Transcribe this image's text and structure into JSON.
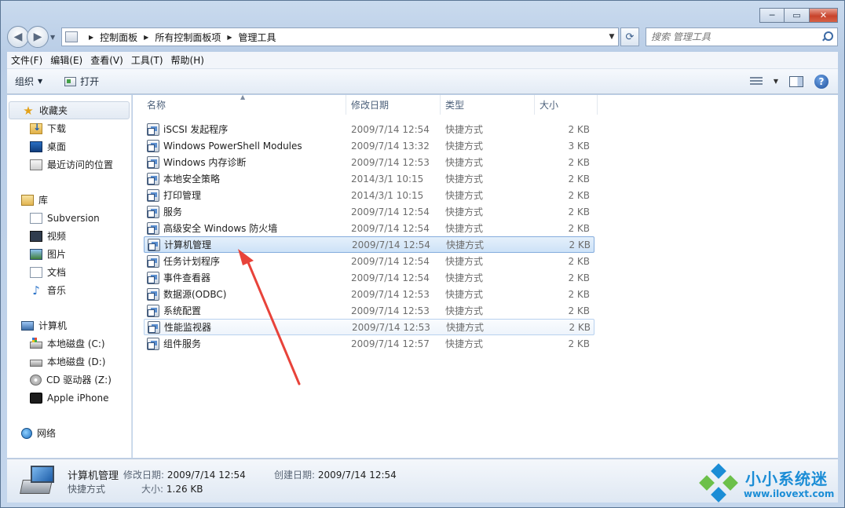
{
  "window": {
    "caption": {
      "min": "─",
      "max": "▭",
      "close": "✕"
    }
  },
  "address": {
    "crumbs": [
      "控制面板",
      "所有控制面板项",
      "管理工具"
    ],
    "search_placeholder": "搜索 管理工具"
  },
  "menu": [
    "文件(F)",
    "编辑(E)",
    "查看(V)",
    "工具(T)",
    "帮助(H)"
  ],
  "toolbar": {
    "organize": "组织",
    "open": "打开",
    "help": "?"
  },
  "nav": {
    "favorites": {
      "title": "收藏夹",
      "items": [
        "下载",
        "桌面",
        "最近访问的位置"
      ]
    },
    "libraries": {
      "title": "库",
      "items": [
        "Subversion",
        "视频",
        "图片",
        "文档",
        "音乐"
      ]
    },
    "computer": {
      "title": "计算机",
      "items": [
        "本地磁盘 (C:)",
        "本地磁盘 (D:)",
        "CD 驱动器 (Z:)",
        "Apple iPhone"
      ]
    },
    "network": {
      "title": "网络"
    }
  },
  "columns": [
    "名称",
    "修改日期",
    "类型",
    "大小"
  ],
  "files": [
    {
      "name": "iSCSI 发起程序",
      "date": "2009/7/14 12:54",
      "type": "快捷方式",
      "size": "2 KB"
    },
    {
      "name": "Windows PowerShell Modules",
      "date": "2009/7/14 13:32",
      "type": "快捷方式",
      "size": "3 KB"
    },
    {
      "name": "Windows 内存诊断",
      "date": "2009/7/14 12:53",
      "type": "快捷方式",
      "size": "2 KB"
    },
    {
      "name": "本地安全策略",
      "date": "2014/3/1 10:15",
      "type": "快捷方式",
      "size": "2 KB"
    },
    {
      "name": "打印管理",
      "date": "2014/3/1 10:15",
      "type": "快捷方式",
      "size": "2 KB"
    },
    {
      "name": "服务",
      "date": "2009/7/14 12:54",
      "type": "快捷方式",
      "size": "2 KB"
    },
    {
      "name": "高级安全 Windows 防火墙",
      "date": "2009/7/14 12:54",
      "type": "快捷方式",
      "size": "2 KB"
    },
    {
      "name": "计算机管理",
      "date": "2009/7/14 12:54",
      "type": "快捷方式",
      "size": "2 KB"
    },
    {
      "name": "任务计划程序",
      "date": "2009/7/14 12:54",
      "type": "快捷方式",
      "size": "2 KB"
    },
    {
      "name": "事件查看器",
      "date": "2009/7/14 12:54",
      "type": "快捷方式",
      "size": "2 KB"
    },
    {
      "name": "数据源(ODBC)",
      "date": "2009/7/14 12:53",
      "type": "快捷方式",
      "size": "2 KB"
    },
    {
      "name": "系统配置",
      "date": "2009/7/14 12:53",
      "type": "快捷方式",
      "size": "2 KB"
    },
    {
      "name": "性能监视器",
      "date": "2009/7/14 12:53",
      "type": "快捷方式",
      "size": "2 KB"
    },
    {
      "name": "组件服务",
      "date": "2009/7/14 12:57",
      "type": "快捷方式",
      "size": "2 KB"
    }
  ],
  "details": {
    "name": "计算机管理",
    "type": "快捷方式",
    "modified_label": "修改日期:",
    "modified": "2009/7/14 12:54",
    "created_label": "创建日期:",
    "created": "2009/7/14 12:54",
    "size_label": "大小:",
    "size": "1.26 KB"
  },
  "watermark": {
    "title": "小小系统迷",
    "url": "www.ilovext.com"
  }
}
